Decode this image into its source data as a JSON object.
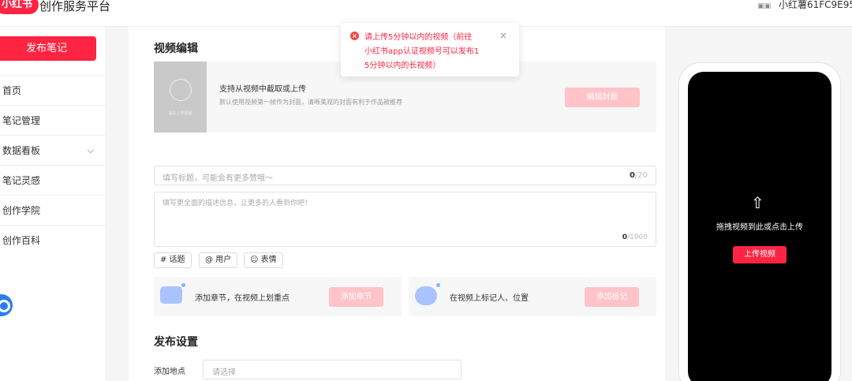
{
  "header": {
    "logo": "小红书",
    "brand": "创作服务平台",
    "user_icon": "user-card-icon",
    "user_name": "小红薯61FC9E95"
  },
  "sidebar": {
    "publish_label": "发布笔记",
    "items": [
      {
        "label": "首页"
      },
      {
        "label": "笔记管理"
      },
      {
        "label": "数据看板",
        "chevron": "chevron-down-icon"
      },
      {
        "label": "笔记灵感"
      },
      {
        "label": "创作学院"
      },
      {
        "label": "创作百科"
      }
    ]
  },
  "editor": {
    "section_title": "视频编辑",
    "cover_thumb_label": "请先上传视频",
    "cover_title": "支持从视频中截取或上传",
    "cover_desc": "默认使用视频第一帧作为封面，清晰美观的封面有利于作品被推荐",
    "edit_cover_label": "编辑封面",
    "title_placeholder": "填写标题，可能会有更多赞哦～",
    "title_count": "0",
    "title_max": "/20",
    "desc_placeholder": "填写更全面的描述信息，让更多的人看到你吧！",
    "desc_count": "0",
    "desc_max": "/1000",
    "tags": [
      "# 话题",
      "@ 用户",
      "表情"
    ],
    "chapter_text": "添加章节，在视频上划重点",
    "chapter_btn": "添加章节",
    "mark_text": "在视频上标记人、位置",
    "mark_btn": "添加标记"
  },
  "publish_settings": {
    "title": "发布设置",
    "location_label": "添加地点",
    "location_placeholder": "请选择"
  },
  "preview": {
    "upload_hint": "拖拽视频到此或点击上传",
    "upload_btn": "上传视频"
  },
  "toast": {
    "lines": [
      "请上传5分钟以内的视频（前往",
      "小红书app认证视频号可以发布1",
      "5分钟以内的长视频）"
    ],
    "icon": "error-icon",
    "close": "×"
  },
  "colors": {
    "brand": "#ff2442",
    "disabled_btn": "#ffc3c8",
    "error": "#f04a48"
  }
}
